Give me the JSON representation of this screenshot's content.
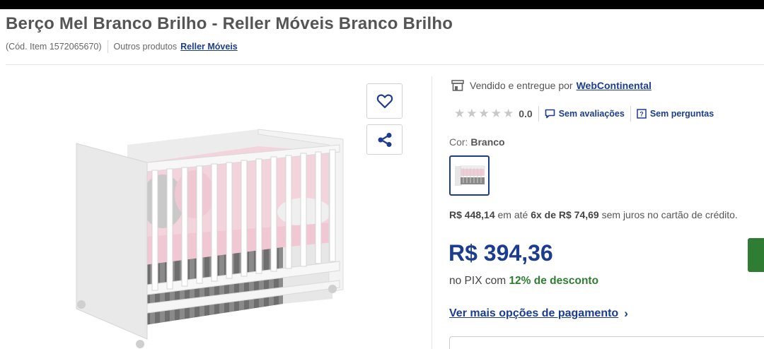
{
  "product": {
    "title": "Berço Mel Branco Brilho - Reller Móveis Branco Brilho",
    "item_code": "(Cód. Item 1572065670)",
    "other_products_label": "Outros produtos",
    "brand_link": "Reller Móveis"
  },
  "actions": {
    "favorite_icon": "heart-icon",
    "share_icon": "share-icon"
  },
  "seller": {
    "prefix": "Vendido e entregue por",
    "name": "WebContinental",
    "icon": "store-icon"
  },
  "rating": {
    "stars_total": 5,
    "value": "0.0",
    "reviews_label": "Sem avaliações",
    "questions_label": "Sem perguntas"
  },
  "color": {
    "label": "Cor:",
    "selected": "Branco"
  },
  "pricing": {
    "list_price": "R$ 448,14",
    "installment_text_1": "em até",
    "installment_count": "6x de R$ 74,69",
    "installment_text_2": "sem juros no cartão de crédito.",
    "price": "R$ 394,36",
    "pix_prefix": "no PIX com",
    "pix_discount": "12% de desconto",
    "more_payment": "Ver mais opções de pagamento"
  },
  "colors": {
    "accent": "#1b3c8f",
    "success": "#2e7d32",
    "star_empty": "#c8c8c8"
  }
}
